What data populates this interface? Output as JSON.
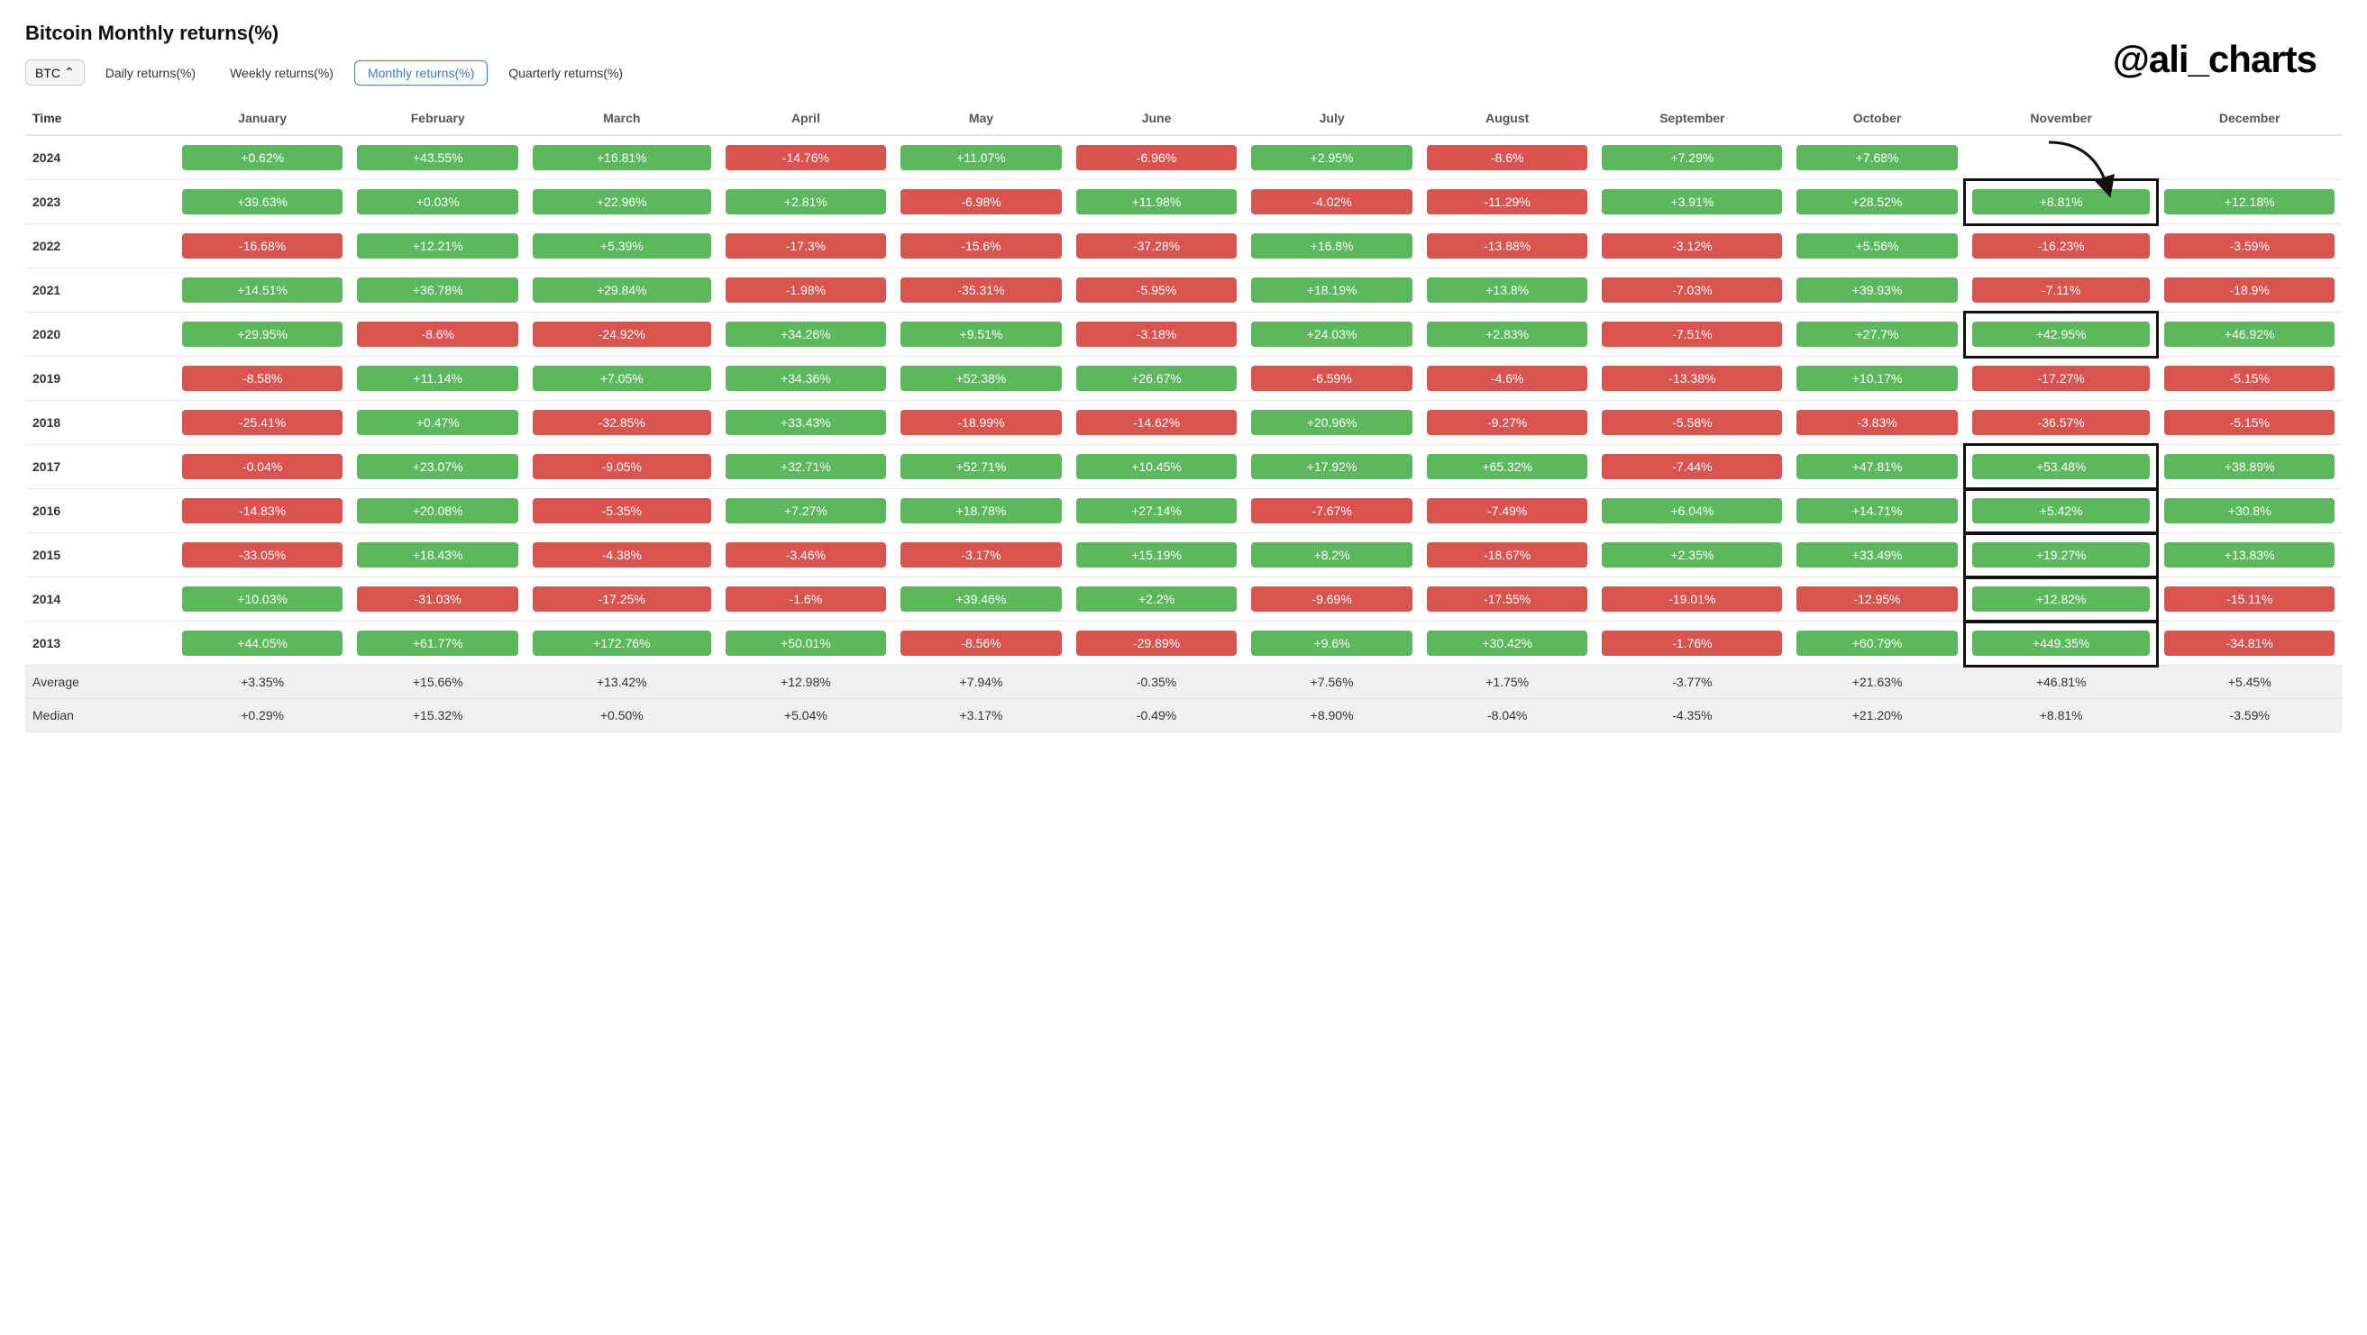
{
  "title": "Bitcoin Monthly returns(%)",
  "watermark": "@ali_charts",
  "toolbar": {
    "btc_label": "BTC",
    "tabs": [
      {
        "label": "Daily returns(%)",
        "active": false
      },
      {
        "label": "Weekly returns(%)",
        "active": false
      },
      {
        "label": "Monthly returns(%)",
        "active": true
      },
      {
        "label": "Quarterly returns(%)",
        "active": false
      }
    ]
  },
  "columns": [
    "Time",
    "January",
    "February",
    "March",
    "April",
    "May",
    "June",
    "July",
    "August",
    "September",
    "October",
    "November",
    "December"
  ],
  "rows": [
    {
      "year": "2024",
      "values": [
        "+0.62%",
        "+43.55%",
        "+16.81%",
        "-14.76%",
        "+11.07%",
        "-6.96%",
        "+2.95%",
        "-8.6%",
        "+7.29%",
        "+7.68%",
        "",
        ""
      ]
    },
    {
      "year": "2023",
      "values": [
        "+39.63%",
        "+0.03%",
        "+22.96%",
        "+2.81%",
        "-6.98%",
        "+11.98%",
        "-4.02%",
        "-11.29%",
        "+3.91%",
        "+28.52%",
        "+8.81%",
        "+12.18%"
      ]
    },
    {
      "year": "2022",
      "values": [
        "-16.68%",
        "+12.21%",
        "+5.39%",
        "-17.3%",
        "-15.6%",
        "-37.28%",
        "+16.8%",
        "-13.88%",
        "-3.12%",
        "+5.56%",
        "-16.23%",
        "-3.59%"
      ]
    },
    {
      "year": "2021",
      "values": [
        "+14.51%",
        "+36.78%",
        "+29.84%",
        "-1.98%",
        "-35.31%",
        "-5.95%",
        "+18.19%",
        "+13.8%",
        "-7.03%",
        "+39.93%",
        "-7.11%",
        "-18.9%"
      ]
    },
    {
      "year": "2020",
      "values": [
        "+29.95%",
        "-8.6%",
        "-24.92%",
        "+34.26%",
        "+9.51%",
        "-3.18%",
        "+24.03%",
        "+2.83%",
        "-7.51%",
        "+27.7%",
        "+42.95%",
        "+46.92%"
      ]
    },
    {
      "year": "2019",
      "values": [
        "-8.58%",
        "+11.14%",
        "+7.05%",
        "+34.36%",
        "+52.38%",
        "+26.67%",
        "-6.59%",
        "-4.6%",
        "-13.38%",
        "+10.17%",
        "-17.27%",
        "-5.15%"
      ]
    },
    {
      "year": "2018",
      "values": [
        "-25.41%",
        "+0.47%",
        "-32.85%",
        "+33.43%",
        "-18.99%",
        "-14.62%",
        "+20.96%",
        "-9.27%",
        "-5.58%",
        "-3.83%",
        "-36.57%",
        "-5.15%"
      ]
    },
    {
      "year": "2017",
      "values": [
        "-0.04%",
        "+23.07%",
        "-9.05%",
        "+32.71%",
        "+52.71%",
        "+10.45%",
        "+17.92%",
        "+65.32%",
        "-7.44%",
        "+47.81%",
        "+53.48%",
        "+38.89%"
      ]
    },
    {
      "year": "2016",
      "values": [
        "-14.83%",
        "+20.08%",
        "-5.35%",
        "+7.27%",
        "+18.78%",
        "+27.14%",
        "-7.67%",
        "-7.49%",
        "+6.04%",
        "+14.71%",
        "+5.42%",
        "+30.8%"
      ]
    },
    {
      "year": "2015",
      "values": [
        "-33.05%",
        "+18.43%",
        "-4.38%",
        "-3.46%",
        "-3.17%",
        "+15.19%",
        "+8.2%",
        "-18.67%",
        "+2.35%",
        "+33.49%",
        "+19.27%",
        "+13.83%"
      ]
    },
    {
      "year": "2014",
      "values": [
        "+10.03%",
        "-31.03%",
        "-17.25%",
        "-1.6%",
        "+39.46%",
        "+2.2%",
        "-9.69%",
        "-17.55%",
        "-19.01%",
        "-12.95%",
        "+12.82%",
        "-15.11%"
      ]
    },
    {
      "year": "2013",
      "values": [
        "+44.05%",
        "+61.77%",
        "+172.76%",
        "+50.01%",
        "-8.56%",
        "-29.89%",
        "+9.6%",
        "+30.42%",
        "-1.76%",
        "+60.79%",
        "+449.35%",
        "-34.81%"
      ]
    }
  ],
  "average_row": {
    "label": "Average",
    "values": [
      "+3.35%",
      "+15.66%",
      "+13.42%",
      "+12.98%",
      "+7.94%",
      "-0.35%",
      "+7.56%",
      "+1.75%",
      "-3.77%",
      "+21.63%",
      "+46.81%",
      "+5.45%"
    ]
  },
  "median_row": {
    "label": "Median",
    "values": [
      "+0.29%",
      "+15.32%",
      "+0.50%",
      "+5.04%",
      "+3.17%",
      "-0.49%",
      "+8.90%",
      "-8.04%",
      "-4.35%",
      "+21.20%",
      "+8.81%",
      "-3.59%"
    ]
  },
  "nov_highlighted_rows": [
    1,
    4,
    7,
    8,
    9,
    10,
    11
  ],
  "colors": {
    "green": "#5cb85c",
    "red": "#d9534f",
    "highlight_border": "#111"
  }
}
